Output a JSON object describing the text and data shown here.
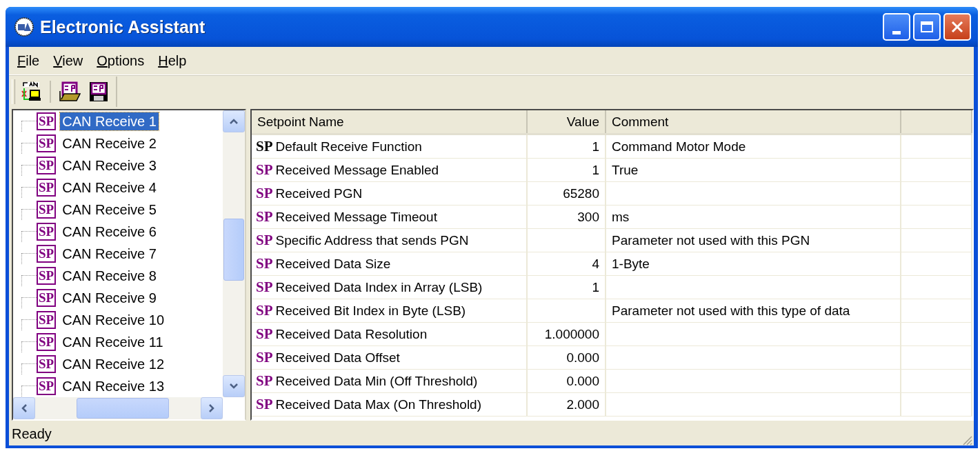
{
  "window": {
    "title": "Electronic Assistant"
  },
  "menu": [
    {
      "label": "File",
      "mnemonic_first": true
    },
    {
      "label": "View",
      "mnemonic_first": true
    },
    {
      "label": "Options",
      "mnemonic_first": true
    },
    {
      "label": "Help",
      "mnemonic_first": true
    }
  ],
  "toolbar": [
    {
      "kind": "can"
    },
    {
      "kind": "open"
    },
    {
      "kind": "save"
    }
  ],
  "tree": {
    "items": [
      {
        "icon": "SP",
        "label": "CAN Receive 1",
        "selected": true
      },
      {
        "icon": "SP",
        "label": "CAN Receive 2",
        "selected": false
      },
      {
        "icon": "SP",
        "label": "CAN Receive 3",
        "selected": false
      },
      {
        "icon": "SP",
        "label": "CAN Receive 4",
        "selected": false
      },
      {
        "icon": "SP",
        "label": "CAN Receive 5",
        "selected": false
      },
      {
        "icon": "SP",
        "label": "CAN Receive 6",
        "selected": false
      },
      {
        "icon": "SP",
        "label": "CAN Receive 7",
        "selected": false
      },
      {
        "icon": "SP",
        "label": "CAN Receive 8",
        "selected": false
      },
      {
        "icon": "SP",
        "label": "CAN Receive 9",
        "selected": false
      },
      {
        "icon": "SP",
        "label": "CAN Receive 10",
        "selected": false
      },
      {
        "icon": "SP",
        "label": "CAN Receive 11",
        "selected": false
      },
      {
        "icon": "SP",
        "label": "CAN Receive 12",
        "selected": false
      },
      {
        "icon": "SP",
        "label": "CAN Receive 13",
        "selected": false
      }
    ]
  },
  "table": {
    "columns": [
      "Setpoint Name",
      "Value",
      "Comment"
    ],
    "rows": [
      {
        "badge": "SP",
        "color": "#000000",
        "name": "Default Receive Function",
        "value": "1",
        "comment": "Command Motor Mode"
      },
      {
        "badge": "SP",
        "color": "#800080",
        "name": "Received Message Enabled",
        "value": "1",
        "comment": "True"
      },
      {
        "badge": "SP",
        "color": "#800080",
        "name": "Received PGN",
        "value": "65280",
        "comment": ""
      },
      {
        "badge": "SP",
        "color": "#800080",
        "name": "Received Message Timeout",
        "value": "300",
        "comment": "ms"
      },
      {
        "badge": "SP",
        "color": "#800080",
        "name": "Specific Address that sends PGN",
        "value": "",
        "comment": "Parameter not used with this PGN"
      },
      {
        "badge": "SP",
        "color": "#800080",
        "name": "Received Data Size",
        "value": "4",
        "comment": "1-Byte"
      },
      {
        "badge": "SP",
        "color": "#800080",
        "name": "Received Data Index in Array (LSB)",
        "value": "1",
        "comment": ""
      },
      {
        "badge": "SP",
        "color": "#800080",
        "name": "Received Bit Index in Byte (LSB)",
        "value": "",
        "comment": "Parameter not used with this type of data"
      },
      {
        "badge": "SP",
        "color": "#800080",
        "name": "Received Data Resolution",
        "value": "1.000000",
        "comment": ""
      },
      {
        "badge": "SP",
        "color": "#800080",
        "name": "Received Data Offset",
        "value": "0.000",
        "comment": ""
      },
      {
        "badge": "SP",
        "color": "#800080",
        "name": "Received Data Min (Off Threshold)",
        "value": "0.000",
        "comment": ""
      },
      {
        "badge": "SP",
        "color": "#800080",
        "name": "Received Data Max (On Threshold)",
        "value": "2.000",
        "comment": ""
      }
    ]
  },
  "status_bar": {
    "text": "Ready"
  }
}
